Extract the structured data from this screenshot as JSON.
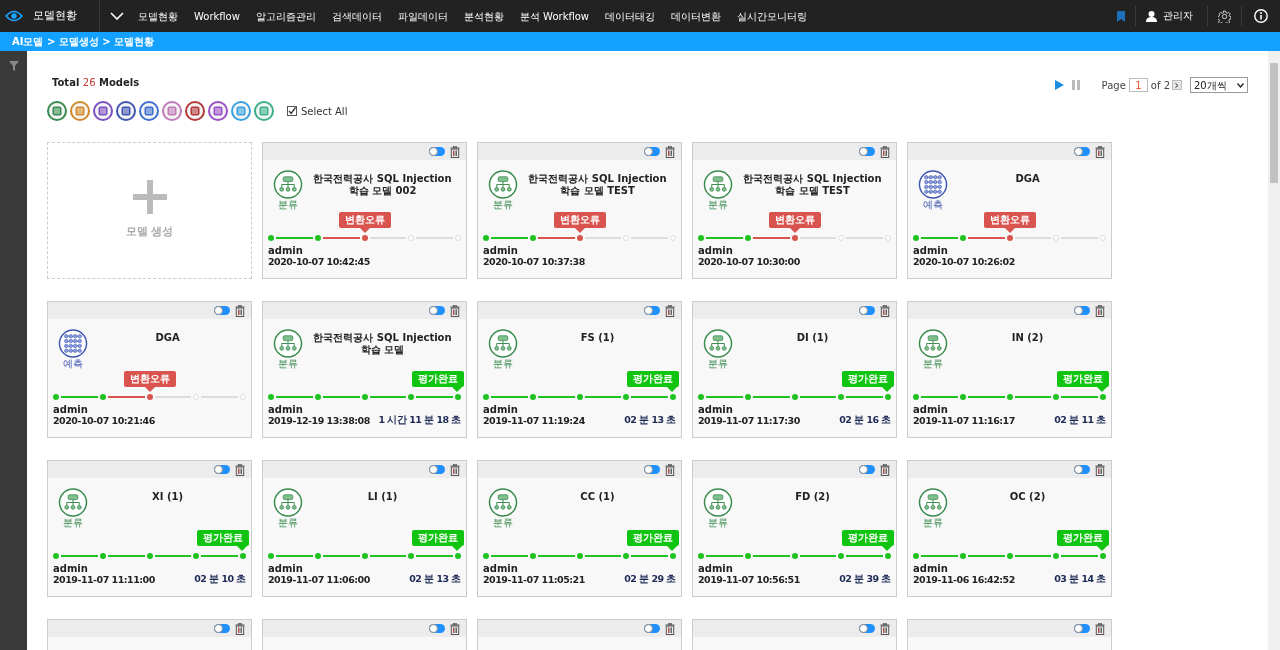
{
  "topbar": {
    "app_title": "모델현황",
    "nav": [
      "모델현황",
      "Workflow",
      "알고리즘관리",
      "검색데이터",
      "파일데이터",
      "분석현황",
      "분석 Workflow",
      "데이터태깅",
      "데이터변환",
      "실시간모니터링"
    ],
    "user": "관리자"
  },
  "breadcrumb": "AI모델 > 모델생성 > 모델현황",
  "summary": {
    "prefix": "Total",
    "count": "26",
    "suffix": "Models"
  },
  "pager": {
    "label": "Page",
    "page": "1",
    "of": "of 2",
    "page_size": "20개씩"
  },
  "type_filters": [
    {
      "color": "#3a8a4e"
    },
    {
      "color": "#d08a2a"
    },
    {
      "color": "#7a4fc0"
    },
    {
      "color": "#3f55b0"
    },
    {
      "color": "#3f6fd0"
    },
    {
      "color": "#c07ab8"
    },
    {
      "color": "#b23a3a"
    },
    {
      "color": "#9a4fc8"
    },
    {
      "color": "#3a9fe0"
    },
    {
      "color": "#3ab08a"
    }
  ],
  "select_all": {
    "label": "Select All",
    "checked": true
  },
  "create_card": {
    "label": "모델 생성"
  },
  "cards": [
    {
      "on": false,
      "title": "한국전력공사 SQL Injection 학습 모델 002",
      "category": {
        "kind": "classification",
        "label": "분류"
      },
      "steps": [
        {
          "done": true,
          "failed": false
        },
        {
          "done": true,
          "failed": false
        },
        {
          "done": false,
          "failed": true
        },
        {
          "done": false,
          "failed": false
        },
        {
          "done": false,
          "failed": false
        }
      ],
      "badge": {
        "kind": "error",
        "label": "변환오류"
      },
      "user": "admin",
      "date": "2020-10-07 10:42:45"
    },
    {
      "on": false,
      "title": "한국전력공사 SQL Injection 학습 모델 TEST",
      "category": {
        "kind": "classification",
        "label": "분류"
      },
      "steps": [
        {
          "done": true,
          "failed": false
        },
        {
          "done": true,
          "failed": false
        },
        {
          "done": false,
          "failed": true
        },
        {
          "done": false,
          "failed": false
        },
        {
          "done": false,
          "failed": false
        }
      ],
      "badge": {
        "kind": "error",
        "label": "변환오류"
      },
      "user": "admin",
      "date": "2020-10-07 10:37:38"
    },
    {
      "on": false,
      "title": "한국전력공사 SQL Injection 학습 모델 TEST",
      "category": {
        "kind": "classification",
        "label": "분류"
      },
      "steps": [
        {
          "done": true,
          "failed": false
        },
        {
          "done": true,
          "failed": false
        },
        {
          "done": false,
          "failed": true
        },
        {
          "done": false,
          "failed": false
        },
        {
          "done": false,
          "failed": false
        }
      ],
      "badge": {
        "kind": "error",
        "label": "변환오류"
      },
      "user": "admin",
      "date": "2020-10-07 10:30:00"
    },
    {
      "on": false,
      "title": "DGA",
      "category": {
        "kind": "prediction",
        "label": "예측"
      },
      "steps": [
        {
          "done": true,
          "failed": false
        },
        {
          "done": true,
          "failed": false
        },
        {
          "done": false,
          "failed": true
        },
        {
          "done": false,
          "failed": false
        },
        {
          "done": false,
          "failed": false
        }
      ],
      "badge": {
        "kind": "error",
        "label": "변환오류"
      },
      "user": "admin",
      "date": "2020-10-07 10:26:02"
    },
    {
      "on": false,
      "title": "DGA",
      "category": {
        "kind": "prediction",
        "label": "예측"
      },
      "steps": [
        {
          "done": true,
          "failed": false
        },
        {
          "done": true,
          "failed": false
        },
        {
          "done": false,
          "failed": true
        },
        {
          "done": false,
          "failed": false
        },
        {
          "done": false,
          "failed": false
        }
      ],
      "badge": {
        "kind": "error",
        "label": "변환오류"
      },
      "user": "admin",
      "date": "2020-10-07 10:21:46"
    },
    {
      "on": false,
      "title": "한국전력공사 SQL Injection 학습 모델",
      "category": {
        "kind": "classification",
        "label": "분류"
      },
      "steps": [
        {
          "done": true,
          "failed": false
        },
        {
          "done": true,
          "failed": false
        },
        {
          "done": true,
          "failed": false
        },
        {
          "done": true,
          "failed": false
        },
        {
          "done": true,
          "failed": false
        }
      ],
      "badge": {
        "kind": "done",
        "label": "평가완료"
      },
      "user": "admin",
      "date": "2019-12-19 13:38:08",
      "duration": "1 시간 11 분 18 초"
    },
    {
      "on": false,
      "title": "FS (1)",
      "category": {
        "kind": "classification",
        "label": "분류"
      },
      "steps": [
        {
          "done": true,
          "failed": false
        },
        {
          "done": true,
          "failed": false
        },
        {
          "done": true,
          "failed": false
        },
        {
          "done": true,
          "failed": false
        },
        {
          "done": true,
          "failed": false
        }
      ],
      "badge": {
        "kind": "done",
        "label": "평가완료"
      },
      "user": "admin",
      "date": "2019-11-07 11:19:24",
      "duration": "02 분 13 초"
    },
    {
      "on": false,
      "title": "DI (1)",
      "category": {
        "kind": "classification",
        "label": "분류"
      },
      "steps": [
        {
          "done": true,
          "failed": false
        },
        {
          "done": true,
          "failed": false
        },
        {
          "done": true,
          "failed": false
        },
        {
          "done": true,
          "failed": false
        },
        {
          "done": true,
          "failed": false
        }
      ],
      "badge": {
        "kind": "done",
        "label": "평가완료"
      },
      "user": "admin",
      "date": "2019-11-07 11:17:30",
      "duration": "02 분 16 초"
    },
    {
      "on": false,
      "title": "IN (2)",
      "category": {
        "kind": "classification",
        "label": "분류"
      },
      "steps": [
        {
          "done": true,
          "failed": false
        },
        {
          "done": true,
          "failed": false
        },
        {
          "done": true,
          "failed": false
        },
        {
          "done": true,
          "failed": false
        },
        {
          "done": true,
          "failed": false
        }
      ],
      "badge": {
        "kind": "done",
        "label": "평가완료"
      },
      "user": "admin",
      "date": "2019-11-07 11:16:17",
      "duration": "02 분 11 초"
    },
    {
      "on": false,
      "title": "XI (1)",
      "category": {
        "kind": "classification",
        "label": "분류"
      },
      "steps": [
        {
          "done": true,
          "failed": false
        },
        {
          "done": true,
          "failed": false
        },
        {
          "done": true,
          "failed": false
        },
        {
          "done": true,
          "failed": false
        },
        {
          "done": true,
          "failed": false
        }
      ],
      "badge": {
        "kind": "done",
        "label": "평가완료"
      },
      "user": "admin",
      "date": "2019-11-07 11:11:00",
      "duration": "02 분 10 초"
    },
    {
      "on": false,
      "title": "LI (1)",
      "category": {
        "kind": "classification",
        "label": "분류"
      },
      "steps": [
        {
          "done": true,
          "failed": false
        },
        {
          "done": true,
          "failed": false
        },
        {
          "done": true,
          "failed": false
        },
        {
          "done": true,
          "failed": false
        },
        {
          "done": true,
          "failed": false
        }
      ],
      "badge": {
        "kind": "done",
        "label": "평가완료"
      },
      "user": "admin",
      "date": "2019-11-07 11:06:00",
      "duration": "02 분 13 초"
    },
    {
      "on": false,
      "title": "CC (1)",
      "category": {
        "kind": "classification",
        "label": "분류"
      },
      "steps": [
        {
          "done": true,
          "failed": false
        },
        {
          "done": true,
          "failed": false
        },
        {
          "done": true,
          "failed": false
        },
        {
          "done": true,
          "failed": false
        },
        {
          "done": true,
          "failed": false
        }
      ],
      "badge": {
        "kind": "done",
        "label": "평가완료"
      },
      "user": "admin",
      "date": "2019-11-07 11:05:21",
      "duration": "02 분 29 초"
    },
    {
      "on": false,
      "title": "FD (2)",
      "category": {
        "kind": "classification",
        "label": "분류"
      },
      "steps": [
        {
          "done": true,
          "failed": false
        },
        {
          "done": true,
          "failed": false
        },
        {
          "done": true,
          "failed": false
        },
        {
          "done": true,
          "failed": false
        },
        {
          "done": true,
          "failed": false
        }
      ],
      "badge": {
        "kind": "done",
        "label": "평가완료"
      },
      "user": "admin",
      "date": "2019-11-07 10:56:51",
      "duration": "02 분 39 초"
    },
    {
      "on": false,
      "title": "OC (2)",
      "category": {
        "kind": "classification",
        "label": "분류"
      },
      "steps": [
        {
          "done": true,
          "failed": false
        },
        {
          "done": true,
          "failed": false
        },
        {
          "done": true,
          "failed": false
        },
        {
          "done": true,
          "failed": false
        },
        {
          "done": true,
          "failed": false
        }
      ],
      "badge": {
        "kind": "done",
        "label": "평가완료"
      },
      "user": "admin",
      "date": "2019-11-06 16:42:52",
      "duration": "03 분 14 초"
    }
  ],
  "cut_cards": [
    {
      "on": false
    },
    {
      "on": false
    },
    {
      "on": false
    },
    {
      "on": false
    },
    {
      "on": false
    }
  ]
}
